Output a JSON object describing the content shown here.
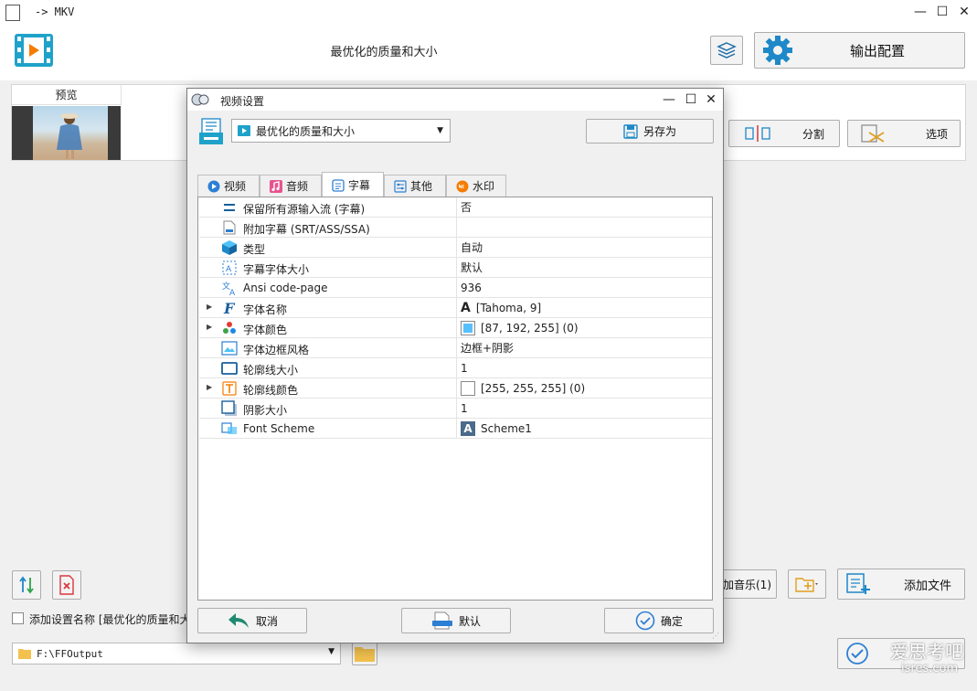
{
  "main": {
    "title": "-> MKV",
    "preset_label": "最优化的质量和大小",
    "output_config_label": "输出配置",
    "preview_header": "预览",
    "split_label": "分割",
    "options_label": "选项",
    "add_music_label": "加音乐(1)",
    "add_file_label": "添加文件",
    "add_name_label": "添加设置名称 [最优化的质量和大小]",
    "output_path": "F:\\FFOutput",
    "watermark": "爱思考吧",
    "watermark_sub": "isres.com"
  },
  "dialog": {
    "title": "视频设置",
    "preset_value": "最优化的质量和大小",
    "save_as_label": "另存为",
    "tabs": [
      {
        "label": "视频",
        "icon": "video-tab-icon"
      },
      {
        "label": "音频",
        "icon": "music-note-icon"
      },
      {
        "label": "字幕",
        "icon": "subtitle-icon",
        "active": true
      },
      {
        "label": "其他",
        "icon": "sliders-icon"
      },
      {
        "label": "水印",
        "icon": "new-badge-icon"
      }
    ],
    "properties": [
      {
        "name": "保留所有源输入流 (字幕)",
        "value": "否",
        "icon": "equals-icon"
      },
      {
        "name": "附加字幕 (SRT/ASS/SSA)",
        "value": "",
        "icon": "subtitle-file-icon"
      },
      {
        "name": "类型",
        "value": "自动",
        "icon": "cube-icon"
      },
      {
        "name": "字幕字体大小",
        "value": "默认",
        "icon": "font-size-icon"
      },
      {
        "name": "Ansi code-page",
        "value": "936",
        "icon": "translate-icon"
      },
      {
        "name": "字体名称",
        "value": "[Tahoma, 9]",
        "icon": "font-f-icon",
        "expandable": true,
        "swatch": "font"
      },
      {
        "name": "字体颜色",
        "value": "[87, 192, 255] (0)",
        "icon": "color-dots-icon",
        "expandable": true,
        "swatch": "#57c0ff"
      },
      {
        "name": "字体边框风格",
        "value": "边框+阴影",
        "icon": "image-frame-icon"
      },
      {
        "name": "轮廓线大小",
        "value": "1",
        "icon": "rectangle-outline-icon"
      },
      {
        "name": "轮廓线颜色",
        "value": "[255, 255, 255] (0)",
        "icon": "text-t-icon",
        "expandable": true,
        "swatch": "#ffffff"
      },
      {
        "name": "阴影大小",
        "value": "1",
        "icon": "shadow-box-icon"
      },
      {
        "name": "Font Scheme",
        "value": "Scheme1",
        "icon": "scheme-icon",
        "swatch": "scheme"
      }
    ],
    "cancel_label": "取消",
    "default_label": "默认",
    "ok_label": "确定"
  },
  "colors": {
    "accent_blue": "#1e88c8",
    "teal": "#1fa2c9",
    "ok_blue": "#2d7fd3"
  }
}
